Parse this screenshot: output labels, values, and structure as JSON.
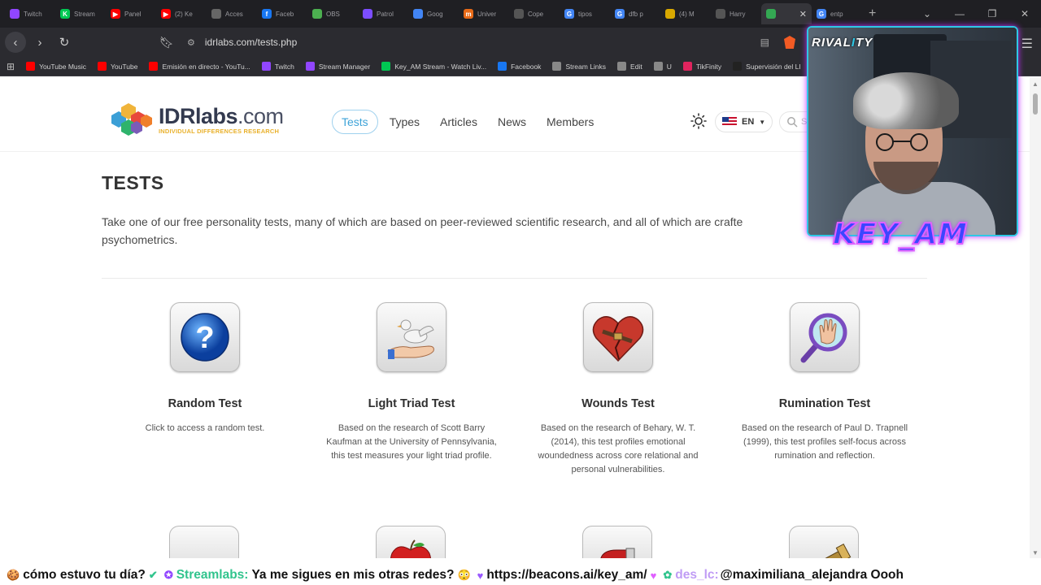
{
  "browser": {
    "tabs": [
      {
        "label": "Twitch",
        "color": "#9146ff",
        "glyph": ""
      },
      {
        "label": "Stream",
        "color": "#00c853",
        "glyph": "K"
      },
      {
        "label": "Panel",
        "color": "#ff0000",
        "glyph": "▶"
      },
      {
        "label": "(2) Ke",
        "color": "#ff0000",
        "glyph": "▶"
      },
      {
        "label": "Acces",
        "color": "#666666",
        "glyph": ""
      },
      {
        "label": "Faceb",
        "color": "#1877f2",
        "glyph": "f"
      },
      {
        "label": "OBS",
        "color": "#4caf50",
        "glyph": ""
      },
      {
        "label": "Patrol",
        "color": "#7c4dff",
        "glyph": ""
      },
      {
        "label": "Goog",
        "color": "#4285f4",
        "glyph": ""
      },
      {
        "label": "Univer",
        "color": "#e86a17",
        "glyph": "m"
      },
      {
        "label": "Cope",
        "color": "#555555",
        "glyph": ""
      },
      {
        "label": "tipos",
        "color": "#4285f4",
        "glyph": "G"
      },
      {
        "label": "dfb p",
        "color": "#4285f4",
        "glyph": "G"
      },
      {
        "label": "(4) M",
        "color": "#d8a800",
        "glyph": ""
      },
      {
        "label": "Harry",
        "color": "#555555",
        "glyph": ""
      }
    ],
    "active_tab_label": "",
    "last_tab_label": "entp",
    "url": "idrlabs.com/tests.php",
    "bookmarks": [
      {
        "label": "YouTube Music",
        "color": "#ff0000"
      },
      {
        "label": "YouTube",
        "color": "#ff0000"
      },
      {
        "label": "Emisión en directo - YouTu...",
        "color": "#ff0000"
      },
      {
        "label": "Twitch",
        "color": "#9146ff"
      },
      {
        "label": "Stream Manager",
        "color": "#9146ff"
      },
      {
        "label": "Key_AM Stream - Watch Liv...",
        "color": "#00c853"
      },
      {
        "label": "Facebook",
        "color": "#1877f2"
      },
      {
        "label": "Stream Links",
        "color": "#888888"
      },
      {
        "label": "Edit",
        "color": "#888888"
      },
      {
        "label": "U",
        "color": "#888888"
      },
      {
        "label": "TikFinity",
        "color": "#e0245e"
      },
      {
        "label": "Supervisión del LI",
        "color": "#222222"
      }
    ]
  },
  "site": {
    "logo_main": "IDRlabs",
    "logo_tld": ".com",
    "logo_sub": "INDIVIDUAL DIFFERENCES RESEARCH",
    "nav": [
      "Tests",
      "Types",
      "Articles",
      "News",
      "Members"
    ],
    "active_nav": "Tests",
    "language": "EN",
    "search_placeholder": "S",
    "page_title": "TESTS",
    "intro": "Take one of our free personality tests, many of which are based on peer-reviewed scientific research, and all of which are crafte psychometrics.",
    "cards": [
      {
        "name": "Random Test",
        "desc": "Click to access a random test.",
        "icon": "question-mark-icon"
      },
      {
        "name": "Light Triad Test",
        "desc": "Based on the research of Scott Barry Kaufman at the University of Pennsylvania, this test measures your light triad profile.",
        "icon": "dove-hand-icon"
      },
      {
        "name": "Wounds Test",
        "desc": "Based on the research of Behary, W. T. (2014), this test profiles emotional woundedness across core relational and personal vulnerabilities.",
        "icon": "broken-heart-icon"
      },
      {
        "name": "Rumination Test",
        "desc": "Based on the research of Paul D. Trapnell (1999), this test profiles self-focus across rumination and reflection.",
        "icon": "magnifier-hand-icon"
      }
    ]
  },
  "overlay": {
    "brand": "RIVAL",
    "brand_eye": "I",
    "brand_tail": "TY",
    "streamer": "KEY_AM"
  },
  "ticker": {
    "part1": "cómo estuvo tu día?",
    "streamlabs": "Streamlabs:",
    "part2": "Ya me sigues en mis otras redes?",
    "url": "https://beacons.ai/key_am/",
    "des": "des_lc:",
    "part3": "@maximiliana_alejandra Oooh"
  }
}
